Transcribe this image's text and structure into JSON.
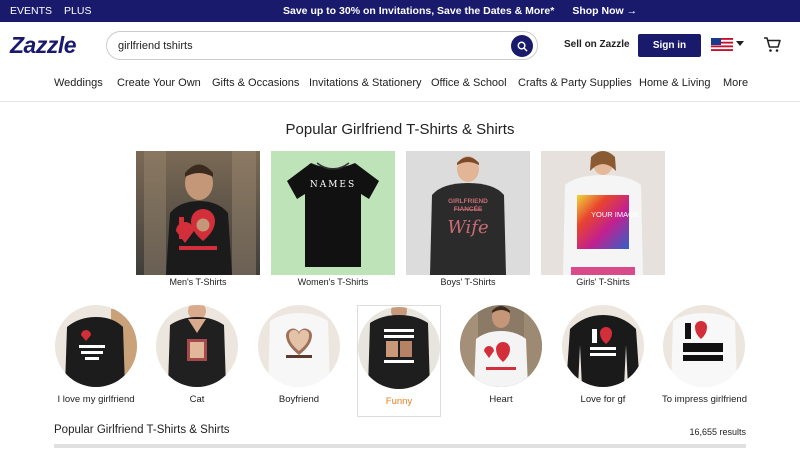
{
  "promo": {
    "events": "EVENTS",
    "plus": "PLUS",
    "message": "Save up to 30% on Invitations, Save the Dates & More*",
    "cta": "Shop Now →"
  },
  "header": {
    "logo": "Zazzle",
    "search_value": "girlfriend tshirts",
    "sell": "Sell on Zazzle",
    "signin": "Sign in"
  },
  "nav": [
    "Weddings",
    "Create Your Own",
    "Gifts & Occasions",
    "Invitations & Stationery",
    "Office & School",
    "Crafts & Party Supplies",
    "Home & Living",
    "More"
  ],
  "page_title": "Popular Girlfriend T-Shirts & Shirts",
  "categories": [
    {
      "label": "Men's T-Shirts"
    },
    {
      "label": "Women's T-Shirts",
      "shirt_text": "NAMES"
    },
    {
      "label": "Boys' T-Shirts",
      "shirt_text_1": "GIRLFRIEND",
      "shirt_text_2": "FIANCÉE",
      "shirt_text_3": "Wife"
    },
    {
      "label": "Girls' T-Shirts",
      "shirt_text": "YOUR IMAGE"
    }
  ],
  "styles": [
    {
      "label": "I love my girlfriend"
    },
    {
      "label": "Cat"
    },
    {
      "label": "Boyfriend"
    },
    {
      "label": "Funny",
      "selected": true
    },
    {
      "label": "Heart"
    },
    {
      "label": "Love for gf"
    },
    {
      "label": "To impress girlfriend"
    }
  ],
  "results": {
    "heading": "Popular Girlfriend T-Shirts & Shirts",
    "count": "16,655 results"
  },
  "colors": {
    "navy": "#1a1a6c",
    "accent": "#e87d1e",
    "heart_red": "#d32f3a"
  }
}
